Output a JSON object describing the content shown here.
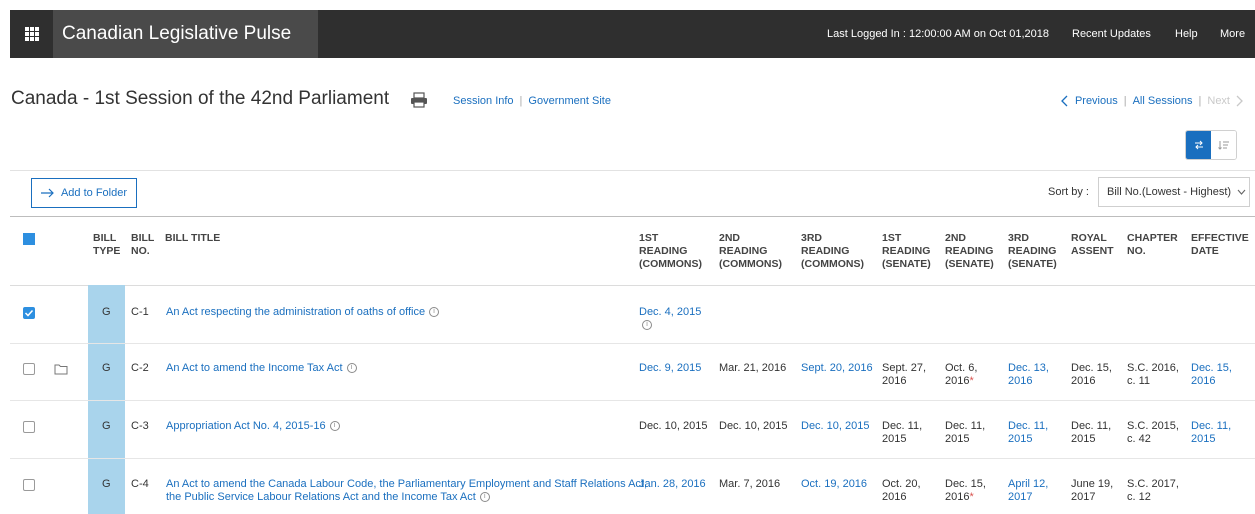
{
  "topbar": {
    "app_title": "Canadian Legislative Pulse",
    "last_logged": "Last Logged In : 12:00:00 AM on Oct 01,2018",
    "nav": [
      "Recent Updates",
      "Help",
      "More"
    ]
  },
  "session": {
    "title": "Canada - 1st Session of the 42nd Parliament",
    "links": [
      "Session Info",
      "Government Site"
    ]
  },
  "pager": {
    "previous": "Previous",
    "all": "All Sessions",
    "next": "Next"
  },
  "toolbar": {
    "add_to_folder": "Add to Folder",
    "sort_label": "Sort by :",
    "sort_value": "Bill No.(Lowest - Highest)"
  },
  "table": {
    "headers": {
      "bill_type": [
        "BILL",
        "TYPE"
      ],
      "bill_no": [
        "BILL",
        "NO."
      ],
      "bill_title": "BILL TITLE",
      "r1c": [
        "1ST",
        "READING",
        "(COMMONS)"
      ],
      "r2c": [
        "2ND",
        "READING",
        "(COMMONS)"
      ],
      "r3c": [
        "3RD",
        "READING",
        "(COMMONS)"
      ],
      "r1s": [
        "1ST",
        "READING",
        "(SENATE)"
      ],
      "r2s": [
        "2ND",
        "READING",
        "(SENATE)"
      ],
      "r3s": [
        "3RD",
        "READING",
        "(SENATE)"
      ],
      "royal": [
        "ROYAL",
        "ASSENT"
      ],
      "chapter": [
        "CHAPTER",
        "NO."
      ],
      "effective": [
        "EFFECTIVE",
        "DATE"
      ]
    },
    "rows": [
      {
        "checked": true,
        "folder": false,
        "type": "G",
        "no": "C-1",
        "title": "An Act respecting the administration of oaths of office",
        "r1c": "Dec. 4, 2015"
      },
      {
        "checked": false,
        "folder": true,
        "type": "G",
        "no": "C-2",
        "title": "An Act to amend the Income Tax Act",
        "r1c": "Dec. 9, 2015",
        "r2c": "Mar. 21, 2016",
        "r3c": "Sept. 20, 2016",
        "r1s": [
          "Sept. 27,",
          "2016"
        ],
        "r2s": [
          "Oct. 6,",
          "2016"
        ],
        "r3s": [
          "Dec. 13,",
          "2016"
        ],
        "royal": [
          "Dec. 15,",
          "2016"
        ],
        "chapter": [
          "S.C. 2016,",
          "c. 11"
        ],
        "effective": [
          "Dec. 15,",
          "2016"
        ]
      },
      {
        "checked": false,
        "folder": false,
        "type": "G",
        "no": "C-3",
        "title": "Appropriation Act No. 4, 2015-16",
        "r1c": "Dec. 10, 2015",
        "r2c": "Dec. 10, 2015",
        "r3c": "Dec. 10, 2015",
        "r1s": [
          "Dec. 11,",
          "2015"
        ],
        "r2s": [
          "Dec. 11,",
          "2015"
        ],
        "r3s": [
          "Dec. 11,",
          "2015"
        ],
        "royal": [
          "Dec. 11,",
          "2015"
        ],
        "chapter": [
          "S.C. 2015,",
          "c. 42"
        ],
        "effective": [
          "Dec. 11,",
          "2015"
        ]
      },
      {
        "checked": false,
        "folder": false,
        "type": "G",
        "no": "C-4",
        "title": [
          "An Act to amend the Canada Labour Code, the Parliamentary Employment and Staff Relations Act,",
          "the Public Service Labour Relations Act and the Income Tax Act"
        ],
        "r1c": "Jan. 28, 2016",
        "r2c": "Mar. 7, 2016",
        "r3c": "Oct. 19, 2016",
        "r1s": [
          "Oct. 20,",
          "2016"
        ],
        "r2s": [
          "Dec. 15,",
          "2016"
        ],
        "r3s": [
          "April 12,",
          "2017"
        ],
        "royal": [
          "June 19,",
          "2017"
        ],
        "chapter": [
          "S.C. 2017,",
          "c. 12"
        ]
      }
    ]
  },
  "colors": {
    "topbar": "#2f2f2f",
    "link": "#1a6fbf",
    "type_column": "#a9d4ec",
    "checkbox": "#2d8fe0"
  }
}
